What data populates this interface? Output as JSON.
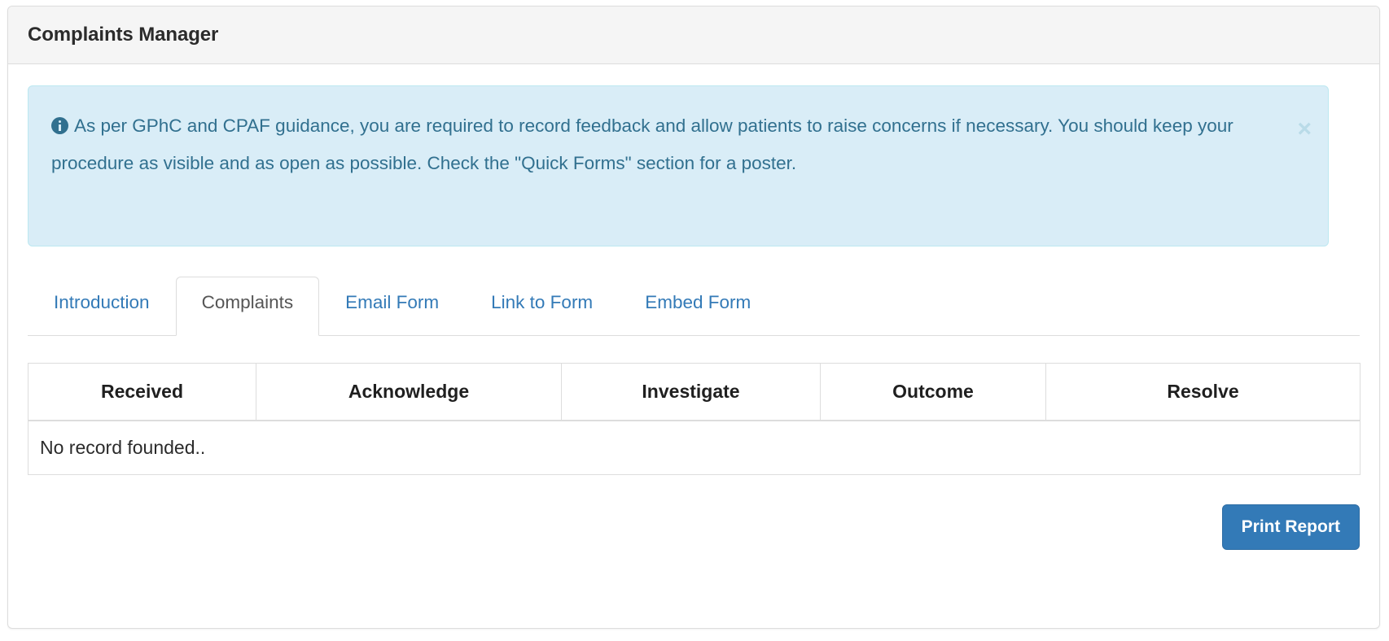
{
  "panel": {
    "title": "Complaints Manager"
  },
  "alert": {
    "icon": "info-circle-icon",
    "message": "As per GPhC and CPAF guidance, you are required to record feedback and allow patients to raise concerns if necessary. You should keep your procedure as visible and as open as possible. Check the \"Quick Forms\" section for a poster.",
    "close_label": "×",
    "background_color": "#d9edf7",
    "border_color": "#bce8f1",
    "text_color": "#31708f"
  },
  "tabs": [
    {
      "label": "Introduction",
      "active": false
    },
    {
      "label": "Complaints",
      "active": true
    },
    {
      "label": "Email Form",
      "active": false
    },
    {
      "label": "Link to Form",
      "active": false
    },
    {
      "label": "Embed Form",
      "active": false
    }
  ],
  "table": {
    "headers": [
      "Received",
      "Acknowledge",
      "Investigate",
      "Outcome",
      "Resolve"
    ],
    "rows": [],
    "empty_message": "No record founded.."
  },
  "actions": {
    "print_report_label": "Print Report",
    "print_report_color": "#337ab7"
  }
}
